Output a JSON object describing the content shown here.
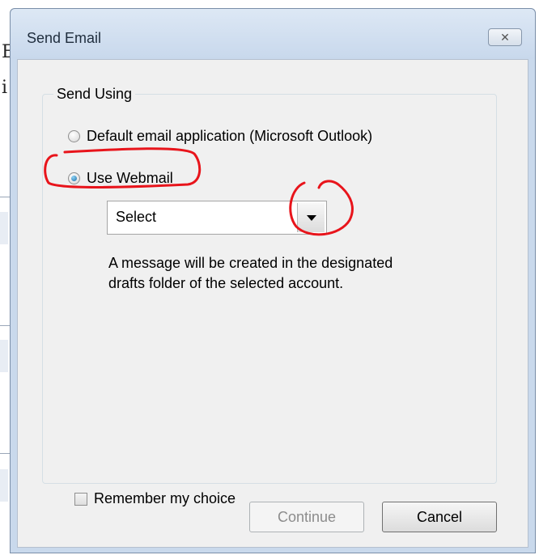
{
  "dialog": {
    "title": "Send Email",
    "close_icon": "close-icon"
  },
  "group": {
    "label": "Send Using",
    "options": [
      {
        "label": "Default email application (Microsoft Outlook)",
        "checked": false
      },
      {
        "label": "Use Webmail",
        "checked": true
      }
    ],
    "account_select": {
      "value": "Select"
    },
    "info": "A message will be created in the designated drafts folder of the selected account."
  },
  "remember": {
    "label": "Remember my choice",
    "checked": false
  },
  "buttons": {
    "continue": "Continue",
    "cancel": "Cancel"
  },
  "annotation_color": "#e8141b"
}
